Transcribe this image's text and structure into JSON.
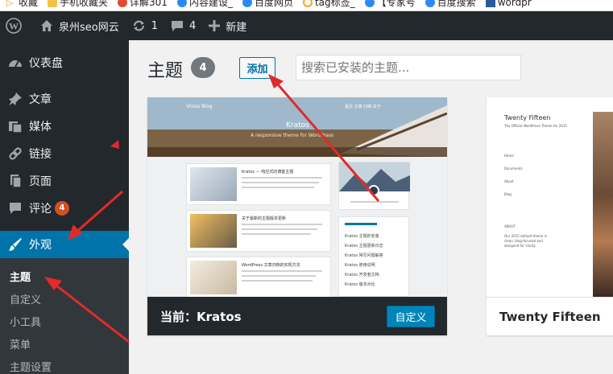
{
  "bookmarks": [
    {
      "label": "收藏",
      "color": "#f5a623"
    },
    {
      "label": "手机收藏夹",
      "color": "#2a8af6"
    },
    {
      "label": "详解301",
      "color": "#e04a2f"
    },
    {
      "label": "内容建设_",
      "color": "#2a8af6"
    },
    {
      "label": "百度网页",
      "color": "#2a8af6"
    },
    {
      "label": "tag标签_",
      "color": "#f5a623"
    },
    {
      "label": "【专家号",
      "color": "#2a8af6"
    },
    {
      "label": "百度搜索",
      "color": "#2a8af6"
    },
    {
      "label": "wordpr",
      "color": "#2a5b9c"
    }
  ],
  "adminbar": {
    "site_name": "泉州seo网云",
    "updates": "1",
    "comments": "4",
    "new": "新建"
  },
  "sidebar": {
    "items": [
      {
        "label": "仪表盘",
        "icon": "dashboard-icon"
      },
      {
        "label": "文章",
        "icon": "pin-icon"
      },
      {
        "label": "媒体",
        "icon": "media-icon"
      },
      {
        "label": "链接",
        "icon": "link-icon"
      },
      {
        "label": "页面",
        "icon": "page-icon"
      },
      {
        "label": "评论",
        "icon": "comment-icon",
        "badge": "4"
      },
      {
        "label": "外观",
        "icon": "appearance-icon",
        "active": true
      }
    ],
    "submenu": [
      "主题",
      "自定义",
      "小工具",
      "菜单",
      "主题设置"
    ]
  },
  "main": {
    "title": "主题",
    "count": "4",
    "add_button": "添加",
    "search_placeholder": "搜索已安装的主题..."
  },
  "themes": {
    "current": {
      "label": "当前：Kratos",
      "customize_button": "自定义",
      "screenshot": {
        "brand": "Vtrois Blog",
        "title": "Kratos",
        "subtitle": "A responsive theme for WordPress",
        "nav": "首页   文章   归档   关于",
        "posts": [
          "Kratos — 响应式的博客主题",
          "关于最新的主题版本更新",
          "WordPress 文章归档的实现方法"
        ],
        "links": [
          "Kratos 主题的安装",
          "Kratos 主题更新日志",
          "Kratos 常见问题解答",
          "Kratos 使用说明",
          "Kratos 开发者文档",
          "Kratos 版本对比"
        ]
      }
    },
    "second": {
      "name": "Twenty Fifteen",
      "screenshot": {
        "title": "Twenty Fifteen",
        "tagline": "The Official WordPress Theme for 2015",
        "menu": [
          "Home",
          "Documents",
          "About",
          "Blog"
        ],
        "about_heading": "ABOUT",
        "about_text": "Our 2015 default theme is clean, blog-focused and designed for clarity."
      }
    }
  },
  "colors": {
    "admin_bg": "#23282d",
    "active_bg": "#0073aa",
    "badge": "#d54e21",
    "annotation": "#e32a2a"
  }
}
